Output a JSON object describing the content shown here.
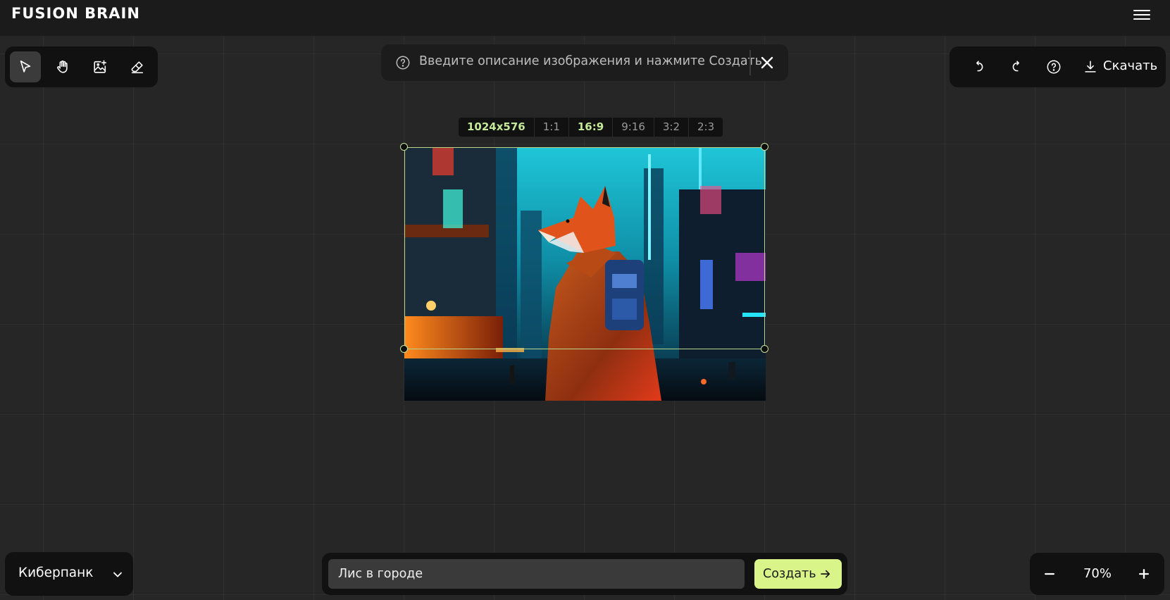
{
  "app": {
    "logo": "FUSION BRAIN"
  },
  "header": {
    "menu_icon": "hamburger-menu-icon"
  },
  "tools": [
    {
      "name": "select",
      "icon": "cursor-arrow-icon",
      "active": true
    },
    {
      "name": "hand",
      "icon": "hand-pan-icon",
      "active": false
    },
    {
      "name": "image-add",
      "icon": "image-plus-icon",
      "active": false
    },
    {
      "name": "eraser",
      "icon": "eraser-icon",
      "active": false
    }
  ],
  "hint": {
    "icon": "question-circle-icon",
    "text": "Введите описание изображения и нажмите Создать",
    "close_icon": "close-icon"
  },
  "actions": {
    "undo_icon": "undo-icon",
    "redo_icon": "redo-icon",
    "help_icon": "question-circle-icon",
    "download_icon": "download-icon",
    "download_label": "Скачать"
  },
  "ratios": {
    "resolution": "1024x576",
    "options": [
      "1:1",
      "16:9",
      "9:16",
      "3:2",
      "2:3"
    ],
    "selected": "16:9"
  },
  "canvas": {
    "image_subject": "fox-in-cyberpunk-city"
  },
  "style_select": {
    "label": "Киберпанк",
    "icon": "chevron-down-icon"
  },
  "prompt": {
    "value": "Лис в городе",
    "placeholder": ""
  },
  "create_button": {
    "label": "Создать",
    "icon": "arrow-right-icon"
  },
  "zoom": {
    "minus_icon": "minus-icon",
    "value": "70%",
    "plus_icon": "plus-icon"
  },
  "colors": {
    "accent": "#d9f58a",
    "selection": "#b9d68a",
    "background": "#262626",
    "panel": "#111111"
  }
}
